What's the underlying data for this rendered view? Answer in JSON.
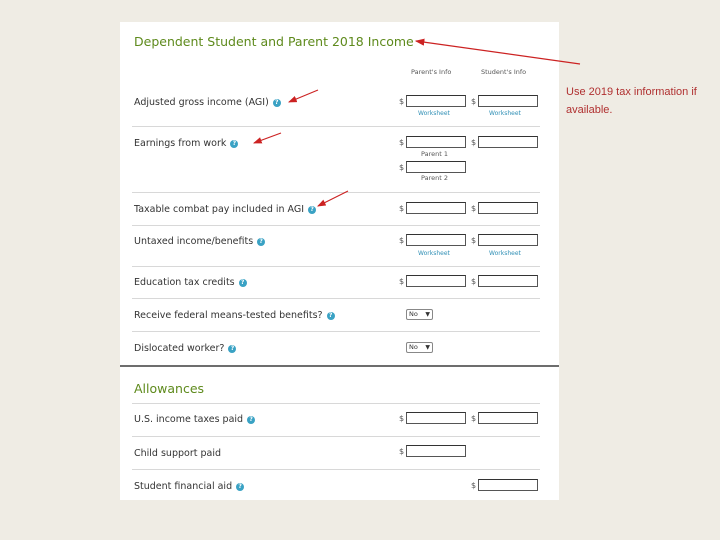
{
  "form": {
    "title": "Dependent Student and Parent 2018 Income",
    "columns": {
      "parent": "Parent's Info",
      "student": "Student's Info"
    },
    "currency_symbol": "$",
    "rows": {
      "agi": {
        "label": "Adjusted gross income (AGI)",
        "parent_link": "Worksheet",
        "student_link": "Worksheet"
      },
      "earnings": {
        "label": "Earnings from work",
        "parent1": "Parent 1",
        "parent2": "Parent 2"
      },
      "combat": {
        "label": "Taxable combat pay included in AGI"
      },
      "untaxed": {
        "label": "Untaxed income/benefits",
        "parent_link": "Worksheet",
        "student_link": "Worksheet"
      },
      "education": {
        "label": "Education tax credits"
      },
      "means_tested": {
        "label": "Receive federal means-tested benefits?",
        "value": "No"
      },
      "dislocated": {
        "label": "Dislocated worker?",
        "value": "No"
      }
    }
  },
  "allowances": {
    "title": "Allowances",
    "rows": {
      "us_tax": {
        "label": "U.S. income taxes paid"
      },
      "child_support": {
        "label": "Child support paid"
      },
      "financial_aid": {
        "label": "Student financial aid"
      }
    }
  },
  "annotation": {
    "note": "Use 2019 tax information if available.",
    "arrow_color": "#cc2222"
  },
  "icons": {
    "help": "question-circle-icon"
  }
}
